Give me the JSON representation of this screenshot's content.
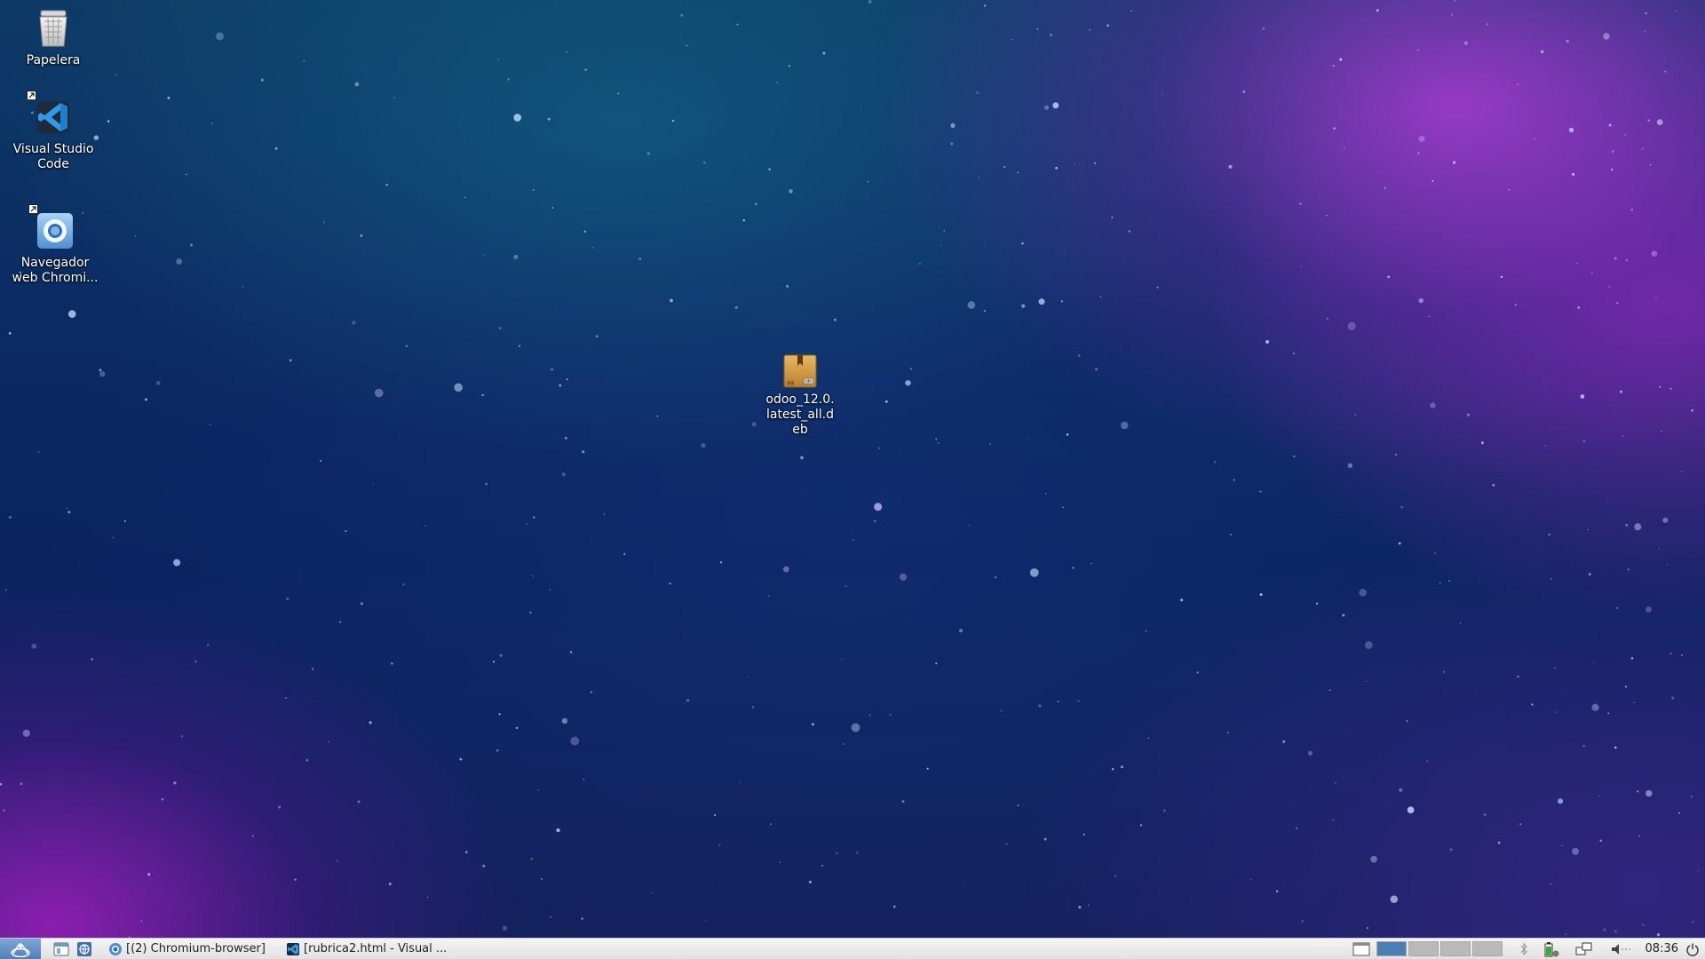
{
  "desktop": {
    "icons": [
      {
        "name": "trash",
        "label": "Papelera",
        "icon": "trash-icon"
      },
      {
        "name": "vscode",
        "label": "Visual Studio Code",
        "icon": "vscode-icon"
      },
      {
        "name": "chromium",
        "label": "Navegador web Chromi...",
        "icon": "chromium-icon"
      },
      {
        "name": "odoo-deb",
        "label": "odoo_12.0.latest_all.deb",
        "icon": "package-icon"
      }
    ]
  },
  "taskbar": {
    "start_icon": "start-menu-icon",
    "quicklaunch": [
      {
        "name": "file-manager",
        "icon": "file-manager-icon"
      },
      {
        "name": "web-browser",
        "icon": "web-browser-icon"
      }
    ],
    "tasks": [
      {
        "label": "[(2) Chromium-browser]",
        "icon": "chromium-icon"
      },
      {
        "label": "[rubrica2.html - Visual ...",
        "icon": "vscode-icon"
      }
    ],
    "workspaces": {
      "count": 4,
      "active_index": 0
    },
    "tray": [
      "window-icon",
      "bluetooth-icon",
      "battery-icon",
      "network-icon",
      "volume-icon",
      "power-icon"
    ],
    "clock": "08:36"
  },
  "colors": {
    "taskbar_bg": "#e6e6e6",
    "workspace_active": "#4a7fb5",
    "workspace_inactive": "#b9b9b9"
  }
}
